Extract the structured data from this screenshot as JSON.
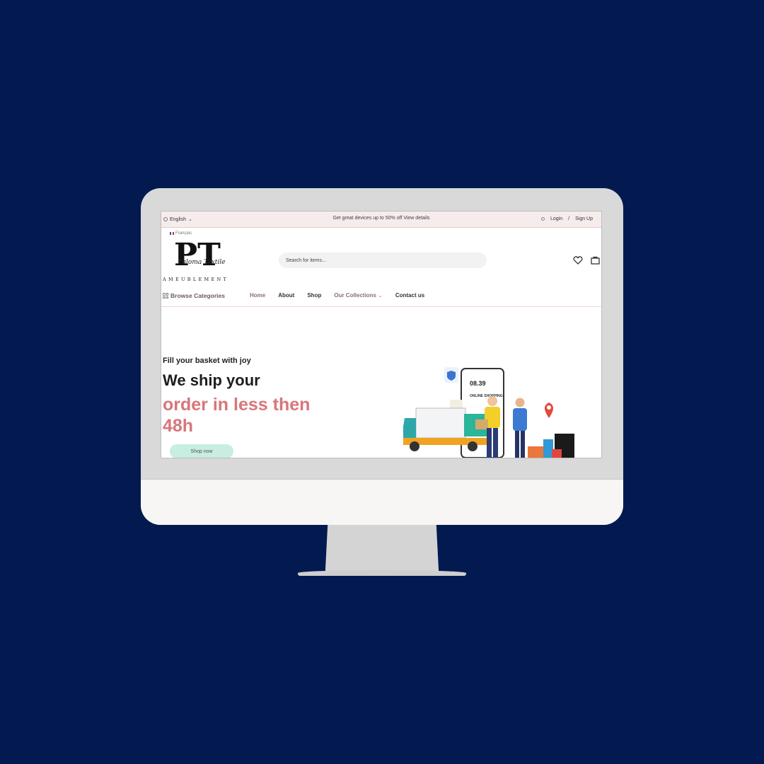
{
  "topbar": {
    "language": "English",
    "promo": "Get great devices up to 50% off View details",
    "login": "Login",
    "separator": "/",
    "signup": "Sign Up"
  },
  "header": {
    "alt_language": "Français",
    "logo_monogram": "PT",
    "logo_script": "Paloma Textile",
    "logo_sub": "AMEUBLEMENT",
    "search_placeholder": "Search for items..."
  },
  "nav": {
    "browse": "Browse Categories",
    "links": [
      "Home",
      "About",
      "Shop",
      "Our Collections",
      "Contact us"
    ]
  },
  "hero": {
    "tagline": "Fill your basket with joy",
    "heading_line1": "We ship your",
    "heading_line2": "order in less then 48h",
    "cta": "Shop now",
    "phone_time": "08.39",
    "phone_banner": "ONLINE SHOPPING"
  },
  "colors": {
    "background": "#021a50",
    "accent": "#d8767a",
    "topbar": "#f7ecec",
    "cta": "#c8ede1"
  }
}
